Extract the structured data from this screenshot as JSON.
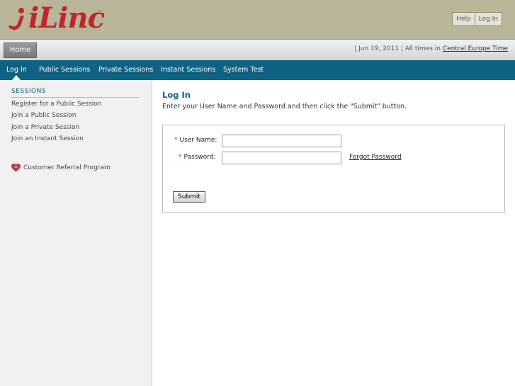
{
  "header": {
    "logo_text": "iLinc",
    "logo_tm": "™",
    "buttons": {
      "help": "Help",
      "login": "Log In"
    }
  },
  "subbar": {
    "home_tab": "Home",
    "date_text": "|  Jun 19, 2011  |  All times in",
    "timezone": "Central Europe Time"
  },
  "nav": {
    "items": [
      {
        "label": "Log In"
      },
      {
        "label": "Public Sessions"
      },
      {
        "label": "Private Sessions"
      },
      {
        "label": "Instant Sessions"
      },
      {
        "label": "System Test"
      }
    ],
    "active": "Log In"
  },
  "sidebar": {
    "heading": "SESSIONS",
    "links": [
      {
        "label": "Register for a Public Session"
      },
      {
        "label": "Join a Public Session"
      },
      {
        "label": "Join a Private Session"
      },
      {
        "label": "Join an Instant Session"
      }
    ],
    "referral": "Customer Referral Program"
  },
  "main": {
    "title": "Log In",
    "instructions": "Enter your User Name and Password and then click the \"Submit\" button.",
    "form": {
      "required_mark": "*",
      "username_label": "User Name:",
      "username_value": "",
      "password_label": "Password:",
      "password_value": "",
      "forgot_link": "Forgot Password",
      "submit_label": "Submit"
    }
  },
  "colors": {
    "header_bg": "#b8b598",
    "brand_red": "#c0262b",
    "nav_bg": "#0f6281",
    "sidebar_bg": "#f1f1f1"
  }
}
